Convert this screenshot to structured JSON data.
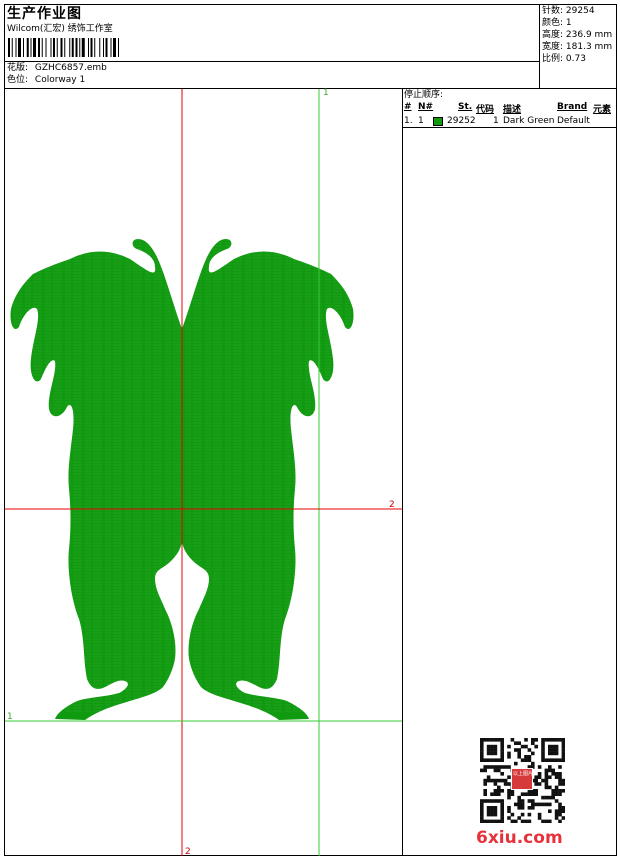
{
  "header": {
    "title": "生产作业图",
    "company": "Wilcom(汇宏) 绣饰工作室",
    "design_label": "花版:",
    "design_value": "GZHC6857.emb",
    "colorway_label": "色位:",
    "colorway_value": "Colorway 1"
  },
  "stats": [
    {
      "label": "针数:",
      "value": "29254"
    },
    {
      "label": "颜色:",
      "value": "1"
    },
    {
      "label": "高度:",
      "value": "236.9 mm"
    },
    {
      "label": "宽度:",
      "value": "181.3 mm"
    },
    {
      "label": "比例:",
      "value": "0.73"
    }
  ],
  "stop_sequence": {
    "heading": "停止顺序:",
    "columns": [
      "#",
      "N#",
      "St.",
      "代码",
      "描述",
      "Brand",
      "元素"
    ],
    "rows": [
      {
        "index": "1.",
        "n": "1",
        "color": "#0f9a0f",
        "stitches": "29252",
        "code": "1",
        "description": "Dark Green",
        "brand": "Default",
        "element": ""
      }
    ]
  },
  "guides": {
    "vertical_labels": [
      "1",
      "2"
    ],
    "horizontal_labels": [
      "2",
      "1"
    ],
    "red_color": "#e60000",
    "green_color": "#33cc33"
  },
  "design_color": "#0f9a0f",
  "watermark": "6xiu.com",
  "seal_text": "以上图片"
}
